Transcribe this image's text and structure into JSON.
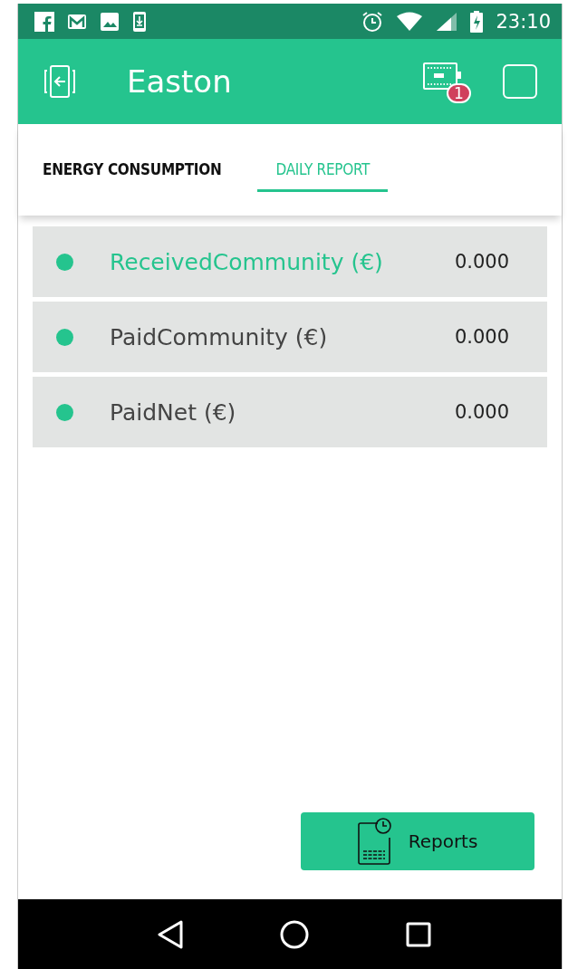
{
  "status_bar": {
    "time": "23:10"
  },
  "app_bar": {
    "title": "Easton",
    "badge": "1"
  },
  "tabs": [
    {
      "label": "ENERGY CONSUMPTION",
      "selected": false
    },
    {
      "label": "DAILY REPORT",
      "selected": true
    }
  ],
  "rows": [
    {
      "label": "ReceivedCommunity (€)",
      "value": "0.000",
      "selected": true,
      "color": "#25c48e"
    },
    {
      "label": "PaidCommunity (€)",
      "value": "0.000",
      "selected": false,
      "color": "#25c48e"
    },
    {
      "label": "PaidNet (€)",
      "value": "0.000",
      "selected": false,
      "color": "#25c48e"
    }
  ],
  "reports_button": {
    "label": "Reports"
  }
}
